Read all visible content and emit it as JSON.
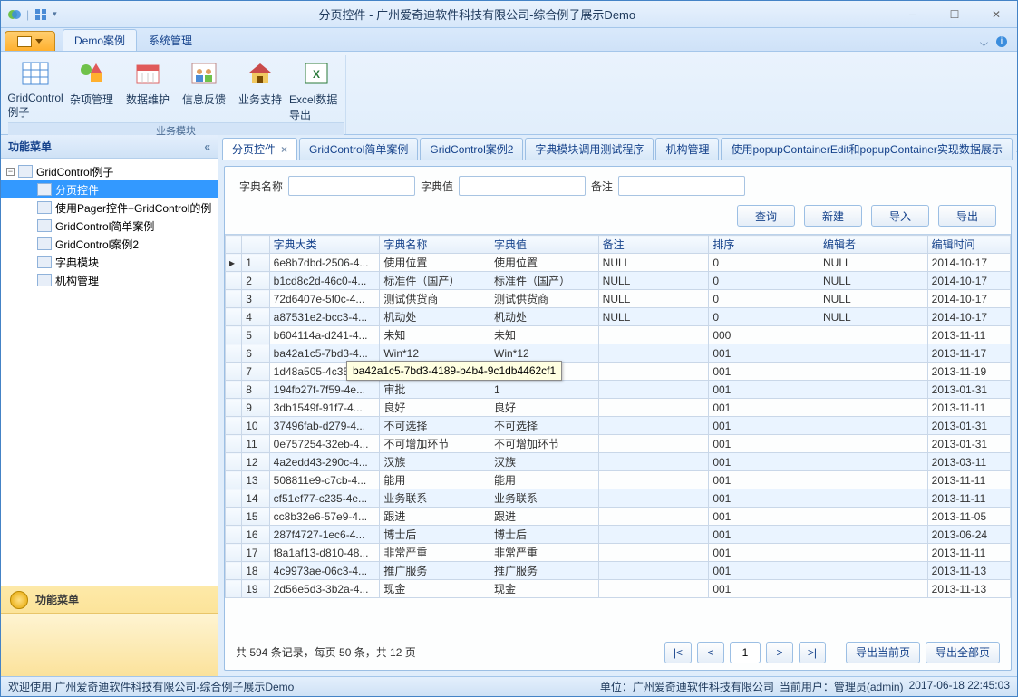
{
  "window_title": "分页控件 - 广州爱奇迪软件科技有限公司-综合例子展示Demo",
  "ribbon_tabs": {
    "demo": "Demo案例",
    "sys": "系统管理"
  },
  "ribbon_items": {
    "grid": "GridControl例子",
    "misc": "杂项管理",
    "data": "数据维护",
    "feedback": "信息反馈",
    "support": "业务支持",
    "excel": "Excel数据导出"
  },
  "ribbon_group_label": "业务模块",
  "nav": {
    "title": "功能菜单",
    "root": "GridControl例子",
    "items": {
      "paging": "分页控件",
      "pager_grid": "使用Pager控件+GridControl的例",
      "simple": "GridControl简单案例",
      "case2": "GridControl案例2",
      "dict": "字典模块",
      "org": "机构管理"
    }
  },
  "doc_tabs": {
    "t0": "分页控件",
    "t1": "GridControl简单案例",
    "t2": "GridControl案例2",
    "t3": "字典模块调用测试程序",
    "t4": "机构管理",
    "t5": "使用popupContainerEdit和popupContainer实现数据展示"
  },
  "filters": {
    "name_lbl": "字典名称",
    "value_lbl": "字典值",
    "remark_lbl": "备注"
  },
  "buttons": {
    "query": "查询",
    "new": "新建",
    "import": "导入",
    "export": "导出",
    "export_cur": "导出当前页",
    "export_all": "导出全部页"
  },
  "columns": {
    "cat": "字典大类",
    "name": "字典名称",
    "val": "字典值",
    "remark": "备注",
    "sort": "排序",
    "editor": "编辑者",
    "time": "编辑时间"
  },
  "rows": [
    {
      "n": "1",
      "cat": "6e8b7dbd-2506-4...",
      "name": "使用位置",
      "val": "使用位置",
      "remark": "NULL",
      "sort": "0",
      "editor": "NULL",
      "time": "2014-10-17"
    },
    {
      "n": "2",
      "cat": "b1cd8c2d-46c0-4...",
      "name": "标准件（国产）",
      "val": "标准件（国产）",
      "remark": "NULL",
      "sort": "0",
      "editor": "NULL",
      "time": "2014-10-17"
    },
    {
      "n": "3",
      "cat": "72d6407e-5f0c-4...",
      "name": "测试供货商",
      "val": "测试供货商",
      "remark": "NULL",
      "sort": "0",
      "editor": "NULL",
      "time": "2014-10-17"
    },
    {
      "n": "4",
      "cat": "a87531e2-bcc3-4...",
      "name": "机动处",
      "val": "机动处",
      "remark": "NULL",
      "sort": "0",
      "editor": "NULL",
      "time": "2014-10-17"
    },
    {
      "n": "5",
      "cat": "b604114a-d241-4...",
      "name": "未知",
      "val": "未知",
      "remark": "",
      "sort": "000",
      "editor": "",
      "time": "2013-11-11"
    },
    {
      "n": "6",
      "cat": "ba42a1c5-7bd3-4...",
      "name": "Win*12",
      "val": "Win*12",
      "remark": "",
      "sort": "001",
      "editor": "",
      "time": "2013-11-17"
    },
    {
      "n": "7",
      "cat": "1d48a505-4c35...",
      "name": "",
      "val": "",
      "remark": "",
      "sort": "001",
      "editor": "",
      "time": "2013-11-19"
    },
    {
      "n": "8",
      "cat": "194fb27f-7f59-4e...",
      "name": "审批",
      "val": "1",
      "remark": "",
      "sort": "001",
      "editor": "",
      "time": "2013-01-31"
    },
    {
      "n": "9",
      "cat": "3db1549f-91f7-4...",
      "name": "良好",
      "val": "良好",
      "remark": "",
      "sort": "001",
      "editor": "",
      "time": "2013-11-11"
    },
    {
      "n": "10",
      "cat": "37496fab-d279-4...",
      "name": "不可选择",
      "val": "不可选择",
      "remark": "",
      "sort": "001",
      "editor": "",
      "time": "2013-01-31"
    },
    {
      "n": "11",
      "cat": "0e757254-32eb-4...",
      "name": "不可增加环节",
      "val": "不可增加环节",
      "remark": "",
      "sort": "001",
      "editor": "",
      "time": "2013-01-31"
    },
    {
      "n": "12",
      "cat": "4a2edd43-290c-4...",
      "name": "汉族",
      "val": "汉族",
      "remark": "",
      "sort": "001",
      "editor": "",
      "time": "2013-03-11"
    },
    {
      "n": "13",
      "cat": "508811e9-c7cb-4...",
      "name": "能用",
      "val": "能用",
      "remark": "",
      "sort": "001",
      "editor": "",
      "time": "2013-11-11"
    },
    {
      "n": "14",
      "cat": "cf51ef77-c235-4e...",
      "name": "业务联系",
      "val": "业务联系",
      "remark": "",
      "sort": "001",
      "editor": "",
      "time": "2013-11-11"
    },
    {
      "n": "15",
      "cat": "cc8b32e6-57e9-4...",
      "name": "跟进",
      "val": "跟进",
      "remark": "",
      "sort": "001",
      "editor": "",
      "time": "2013-11-05"
    },
    {
      "n": "16",
      "cat": "287f4727-1ec6-4...",
      "name": "博士后",
      "val": "博士后",
      "remark": "",
      "sort": "001",
      "editor": "",
      "time": "2013-06-24"
    },
    {
      "n": "17",
      "cat": "f8a1af13-d810-48...",
      "name": "非常严重",
      "val": "非常严重",
      "remark": "",
      "sort": "001",
      "editor": "",
      "time": "2013-11-11"
    },
    {
      "n": "18",
      "cat": "4c9973ae-06c3-4...",
      "name": "推广服务",
      "val": "推广服务",
      "remark": "",
      "sort": "001",
      "editor": "",
      "time": "2013-11-13"
    },
    {
      "n": "19",
      "cat": "2d56e5d3-3b2a-4...",
      "name": "现金",
      "val": "现金",
      "remark": "",
      "sort": "001",
      "editor": "",
      "time": "2013-11-13"
    }
  ],
  "tooltip": "ba42a1c5-7bd3-4189-b4b4-9c1db4462cf1",
  "pager": {
    "info": "共 594 条记录，每页 50 条，共 12 页",
    "page": "1"
  },
  "status": {
    "welcome": "欢迎使用 广州爱奇迪软件科技有限公司-综合例子展示Demo",
    "company": "单位：广州爱奇迪软件科技有限公司",
    "user": "当前用户：管理员(admin)",
    "datetime": "2017-06-18 22:45:03"
  }
}
